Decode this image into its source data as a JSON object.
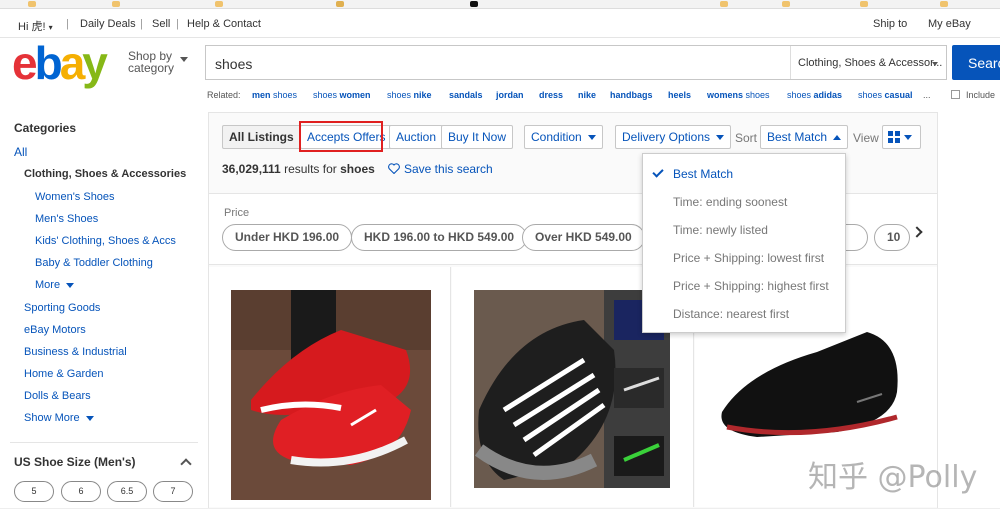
{
  "topbar": {
    "greeting": "Hi 虎!",
    "daily_deals": "Daily Deals",
    "sell": "Sell",
    "help": "Help & Contact",
    "ship_to": "Ship to",
    "my_ebay": "My eBay"
  },
  "header": {
    "logo": {
      "e": "e",
      "b": "b",
      "a": "a",
      "y": "y"
    },
    "shop_by": "Shop by category",
    "search_value": "shoes",
    "category_select": "Clothing, Shoes & Accessor...",
    "search_button": "Search"
  },
  "related": {
    "label": "Related:",
    "items": [
      {
        "pre": "",
        "bold": "men",
        "post": " shoes"
      },
      {
        "pre": "shoes ",
        "bold": "women",
        "post": ""
      },
      {
        "pre": "shoes ",
        "bold": "nike",
        "post": ""
      },
      {
        "pre": "",
        "bold": "sandals",
        "post": ""
      },
      {
        "pre": "",
        "bold": "jordan",
        "post": ""
      },
      {
        "pre": "",
        "bold": "dress",
        "post": ""
      },
      {
        "pre": "",
        "bold": "nike",
        "post": ""
      },
      {
        "pre": "",
        "bold": "handbags",
        "post": ""
      },
      {
        "pre": "",
        "bold": "heels",
        "post": ""
      },
      {
        "pre": "",
        "bold": "womens",
        "post": " shoes"
      },
      {
        "pre": "shoes ",
        "bold": "adidas",
        "post": ""
      },
      {
        "pre": "shoes ",
        "bold": "casual",
        "post": ""
      }
    ],
    "more": "...",
    "include_label": "Include"
  },
  "sidebar": {
    "categories_title": "Categories",
    "all": "All",
    "current": "Clothing, Shoes & Accessories",
    "subcategories": [
      "Women's Shoes",
      "Men's Shoes",
      "Kids' Clothing, Shoes & Accs",
      "Baby & Toddler Clothing"
    ],
    "more": "More",
    "categories": [
      "Sporting Goods",
      "eBay Motors",
      "Business & Industrial",
      "Home & Garden",
      "Dolls & Bears"
    ],
    "show_more": "Show More",
    "size_title": "US Shoe Size (Men's)",
    "sizes": [
      "5",
      "6",
      "6.5",
      "7"
    ]
  },
  "toolbar": {
    "tabs": [
      "All Listings",
      "Accepts Offers",
      "Auction",
      "Buy It Now"
    ],
    "condition": "Condition",
    "delivery": "Delivery Options",
    "sort_label": "Sort",
    "sort_value": "Best Match",
    "view_label": "View"
  },
  "results": {
    "count": "36,029,111",
    "results_for": "results for",
    "query": "shoes",
    "save_search": "Save this search"
  },
  "price_filter": {
    "label": "Price",
    "options": [
      "Under HKD 196.00",
      "HKD 196.00 to HKD 549.00",
      "Over HKD 549.00"
    ],
    "partial": [
      ".5",
      "10"
    ]
  },
  "sort_menu": {
    "options": [
      "Best Match",
      "Time: ending soonest",
      "Time: newly listed",
      "Price + Shipping: lowest first",
      "Price + Shipping: highest first",
      "Distance: nearest first"
    ],
    "selected": "Best Match"
  },
  "watermark": "知乎 @Polly",
  "colors": {
    "link": "#0654ba",
    "search_button": "#0654ba",
    "highlight": "#e02020",
    "logo_e": "#e53238",
    "logo_b": "#0064d2",
    "logo_a": "#f5af02",
    "logo_y": "#86b817"
  }
}
